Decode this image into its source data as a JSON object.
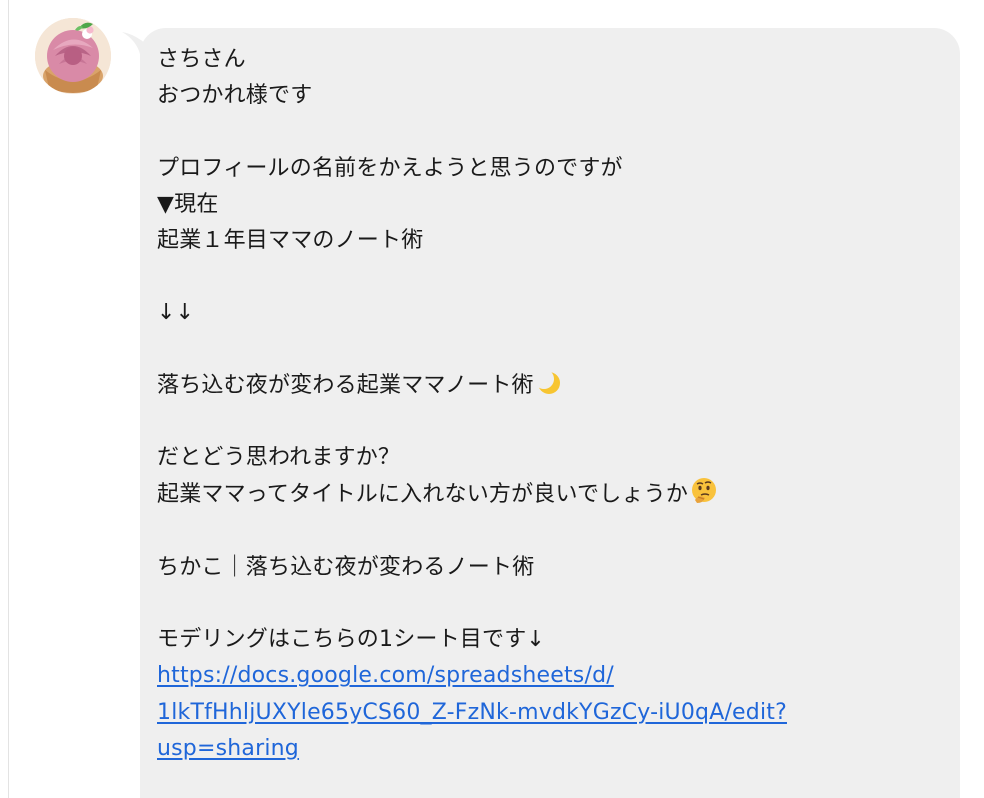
{
  "message": {
    "lines": [
      "さちさん",
      "おつかれ様です",
      "",
      "プロフィールの名前をかえようと思うのですが",
      "▼現在",
      "起業１年目ママのノート術",
      "",
      "↓↓",
      "",
      "落ち込む夜が変わる起業ママノート術",
      "",
      "だとどう思われますか？",
      "起業ママってタイトルに入れない方が良いでしょうか",
      "",
      "ちかこ｜落ち込む夜が変わるノート術",
      "",
      "モデリングはこちらの1シート目です↓"
    ],
    "link_lines": [
      "https://docs.google.com/spreadsheets/d/",
      "1lkTfHhljUXYle65yCS60_Z-FzNk-mvdkYGzCy-iU0qA/edit?",
      "usp=sharing"
    ],
    "emoji": {
      "line_9": "crescent-moon-icon",
      "line_12": "thinking-face-icon"
    }
  },
  "colors": {
    "bubble": "#efefef",
    "link": "#1f66d9",
    "text": "#1a1a1a"
  }
}
